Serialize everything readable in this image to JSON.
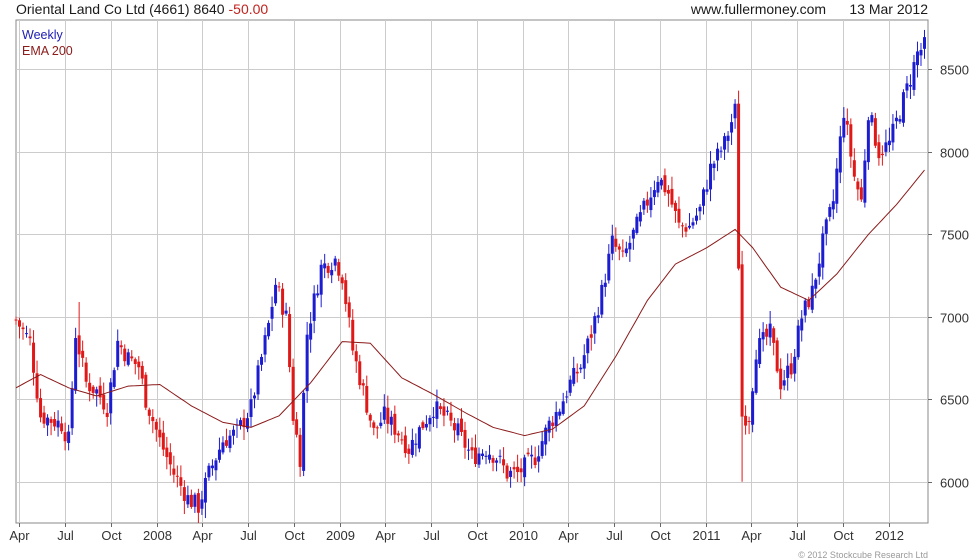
{
  "header": {
    "company": "Oriental Land Co Ltd (4661)",
    "price": "8640",
    "change": "-50.00",
    "site": "www.fullermoney.com",
    "date": "13 Mar 2012"
  },
  "legend": {
    "weekly": "Weekly",
    "ema": "EMA 200"
  },
  "copyright": "© 2012 Stockcube Research Ltd",
  "colors": {
    "up": "#1c1cd0",
    "down": "#e01818",
    "ema": "#8b1a1a",
    "grid": "#cccccc"
  },
  "chart_data": {
    "type": "candlestick",
    "y_range": [
      5750,
      8800
    ],
    "y_ticks": [
      6000,
      6500,
      7000,
      7500,
      8000,
      8500
    ],
    "x_range": [
      "2007-03-26",
      "2012-03-19"
    ],
    "x_ticks": [
      {
        "date": "2007-04-01",
        "label": "Apr"
      },
      {
        "date": "2007-07-01",
        "label": "Jul"
      },
      {
        "date": "2007-10-01",
        "label": "Oct"
      },
      {
        "date": "2008-01-01",
        "label": "2008"
      },
      {
        "date": "2008-04-01",
        "label": "Apr"
      },
      {
        "date": "2008-07-01",
        "label": "Jul"
      },
      {
        "date": "2008-10-01",
        "label": "Oct"
      },
      {
        "date": "2009-01-01",
        "label": "2009"
      },
      {
        "date": "2009-04-01",
        "label": "Apr"
      },
      {
        "date": "2009-07-01",
        "label": "Jul"
      },
      {
        "date": "2009-10-01",
        "label": "Oct"
      },
      {
        "date": "2010-01-01",
        "label": "2010"
      },
      {
        "date": "2010-04-01",
        "label": "Apr"
      },
      {
        "date": "2010-07-01",
        "label": "Jul"
      },
      {
        "date": "2010-10-01",
        "label": "Oct"
      },
      {
        "date": "2011-01-01",
        "label": "2011"
      },
      {
        "date": "2011-04-01",
        "label": "Apr"
      },
      {
        "date": "2011-07-01",
        "label": "Jul"
      },
      {
        "date": "2011-10-01",
        "label": "Oct"
      },
      {
        "date": "2012-01-01",
        "label": "2012"
      }
    ],
    "close_keypoints": [
      [
        "2007-03-26",
        6980
      ],
      [
        "2007-04-23",
        6850
      ],
      [
        "2007-05-14",
        6400
      ],
      [
        "2007-06-25",
        6350
      ],
      [
        "2007-07-09",
        6250
      ],
      [
        "2007-07-23",
        6900
      ],
      [
        "2007-08-13",
        6600
      ],
      [
        "2007-09-03",
        6550
      ],
      [
        "2007-09-24",
        6450
      ],
      [
        "2007-10-15",
        6850
      ],
      [
        "2007-11-05",
        6750
      ],
      [
        "2007-11-26",
        6700
      ],
      [
        "2007-12-10",
        6500
      ],
      [
        "2008-01-07",
        6250
      ],
      [
        "2008-02-04",
        6050
      ],
      [
        "2008-03-03",
        5900
      ],
      [
        "2008-03-24",
        5850
      ],
      [
        "2008-04-14",
        6050
      ],
      [
        "2008-05-12",
        6250
      ],
      [
        "2008-06-09",
        6300
      ],
      [
        "2008-07-07",
        6450
      ],
      [
        "2008-07-28",
        6750
      ],
      [
        "2008-08-11",
        6950
      ],
      [
        "2008-08-25",
        7200
      ],
      [
        "2008-09-15",
        7000
      ],
      [
        "2008-09-29",
        6400
      ],
      [
        "2008-10-13",
        6150
      ],
      [
        "2008-10-27",
        6900
      ],
      [
        "2008-11-24",
        7300
      ],
      [
        "2008-12-22",
        7350
      ],
      [
        "2009-01-05",
        7250
      ],
      [
        "2009-01-26",
        6800
      ],
      [
        "2009-02-16",
        6550
      ],
      [
        "2009-03-09",
        6300
      ],
      [
        "2009-03-30",
        6400
      ],
      [
        "2009-04-27",
        6300
      ],
      [
        "2009-05-18",
        6200
      ],
      [
        "2009-06-15",
        6350
      ],
      [
        "2009-07-06",
        6450
      ],
      [
        "2009-07-27",
        6400
      ],
      [
        "2009-08-24",
        6300
      ],
      [
        "2009-09-21",
        6150
      ],
      [
        "2009-10-19",
        6200
      ],
      [
        "2009-11-09",
        6150
      ],
      [
        "2009-11-30",
        6050
      ],
      [
        "2009-12-21",
        6050
      ],
      [
        "2010-01-25",
        6150
      ],
      [
        "2010-02-22",
        6350
      ],
      [
        "2010-03-15",
        6450
      ],
      [
        "2010-04-05",
        6600
      ],
      [
        "2010-04-26",
        6700
      ],
      [
        "2010-05-17",
        6900
      ],
      [
        "2010-06-07",
        7150
      ],
      [
        "2010-06-28",
        7450
      ],
      [
        "2010-07-19",
        7350
      ],
      [
        "2010-08-09",
        7500
      ],
      [
        "2010-09-06",
        7700
      ],
      [
        "2010-09-27",
        7850
      ],
      [
        "2010-10-18",
        7750
      ],
      [
        "2010-11-08",
        7550
      ],
      [
        "2010-11-29",
        7550
      ],
      [
        "2010-12-20",
        7650
      ],
      [
        "2011-01-10",
        7900
      ],
      [
        "2011-02-07",
        8050
      ],
      [
        "2011-02-28",
        8250
      ],
      [
        "2011-03-14",
        6400
      ],
      [
        "2011-03-28",
        6400
      ],
      [
        "2011-04-11",
        6800
      ],
      [
        "2011-05-09",
        6900
      ],
      [
        "2011-05-30",
        6600
      ],
      [
        "2011-06-20",
        6700
      ],
      [
        "2011-07-11",
        7000
      ],
      [
        "2011-08-01",
        7150
      ],
      [
        "2011-08-22",
        7450
      ],
      [
        "2011-09-12",
        7700
      ],
      [
        "2011-10-03",
        8250
      ],
      [
        "2011-10-24",
        7850
      ],
      [
        "2011-11-07",
        7700
      ],
      [
        "2011-11-21",
        8250
      ],
      [
        "2011-12-12",
        8000
      ],
      [
        "2012-01-02",
        8050
      ],
      [
        "2012-01-23",
        8250
      ],
      [
        "2012-02-13",
        8450
      ],
      [
        "2012-02-27",
        8600
      ],
      [
        "2012-03-12",
        8640
      ]
    ],
    "ema200_keypoints": [
      [
        "2007-03-26",
        6570
      ],
      [
        "2007-05-14",
        6650
      ],
      [
        "2007-07-09",
        6570
      ],
      [
        "2007-09-03",
        6520
      ],
      [
        "2007-11-05",
        6580
      ],
      [
        "2008-01-07",
        6590
      ],
      [
        "2008-03-10",
        6460
      ],
      [
        "2008-05-12",
        6360
      ],
      [
        "2008-07-07",
        6330
      ],
      [
        "2008-09-01",
        6400
      ],
      [
        "2008-11-03",
        6600
      ],
      [
        "2009-01-05",
        6850
      ],
      [
        "2009-03-02",
        6840
      ],
      [
        "2009-05-04",
        6630
      ],
      [
        "2009-07-06",
        6530
      ],
      [
        "2009-09-07",
        6420
      ],
      [
        "2009-11-02",
        6330
      ],
      [
        "2010-01-04",
        6280
      ],
      [
        "2010-03-01",
        6320
      ],
      [
        "2010-05-03",
        6460
      ],
      [
        "2010-07-05",
        6760
      ],
      [
        "2010-09-06",
        7100
      ],
      [
        "2010-11-01",
        7320
      ],
      [
        "2011-01-03",
        7420
      ],
      [
        "2011-02-28",
        7530
      ],
      [
        "2011-04-04",
        7420
      ],
      [
        "2011-05-30",
        7180
      ],
      [
        "2011-07-25",
        7100
      ],
      [
        "2011-09-19",
        7260
      ],
      [
        "2011-11-21",
        7500
      ],
      [
        "2012-01-16",
        7680
      ],
      [
        "2012-03-12",
        7890
      ]
    ],
    "spike_lows": [
      [
        "2011-03-14",
        6000
      ],
      [
        "2008-10-13",
        6030
      ],
      [
        "2008-04-07",
        5780
      ]
    ],
    "spike_highs": [
      [
        "2011-03-14",
        7400
      ],
      [
        "2007-07-30",
        7090
      ],
      [
        "2011-02-28",
        8320
      ]
    ]
  }
}
